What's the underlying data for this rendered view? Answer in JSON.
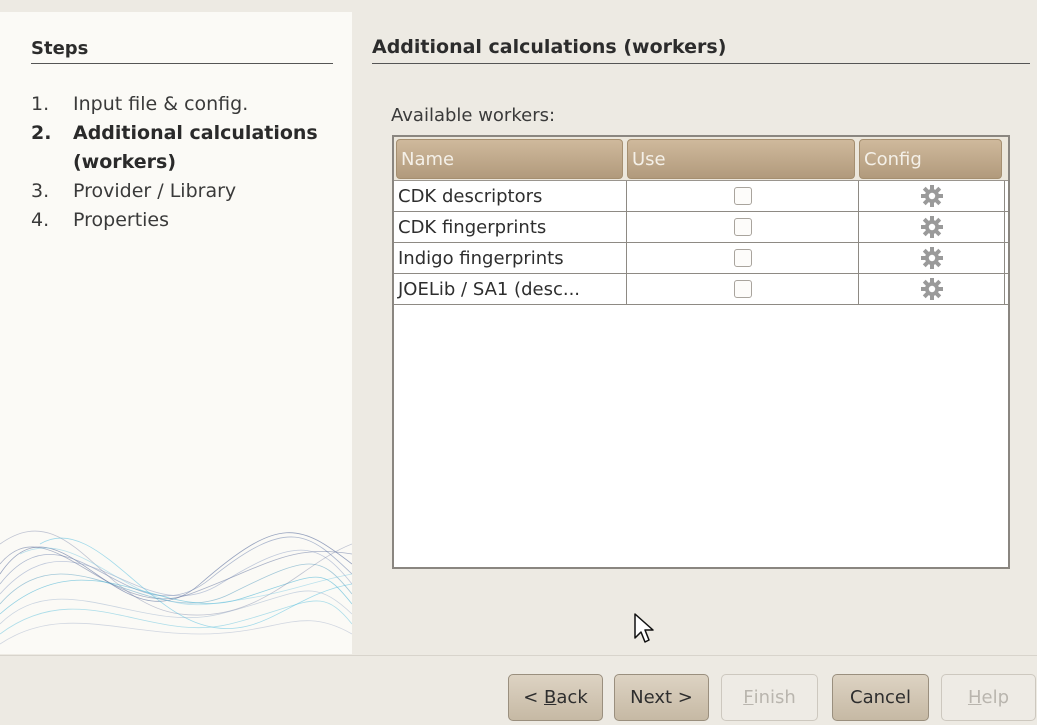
{
  "steps": {
    "title": "Steps",
    "items": [
      {
        "num": "1.",
        "label": "Input file & config.",
        "active": false
      },
      {
        "num": "2.",
        "label": "Additional calculations (workers)",
        "active": true
      },
      {
        "num": "3.",
        "label": "Provider / Library",
        "active": false
      },
      {
        "num": "4.",
        "label": "Properties",
        "active": false
      }
    ]
  },
  "content": {
    "title": "Additional calculations (workers)",
    "available_label": "Available workers:"
  },
  "table": {
    "columns": [
      "Name",
      "Use",
      "Config"
    ],
    "rows": [
      {
        "name": "CDK descriptors",
        "use": false,
        "config_icon": "gear-icon"
      },
      {
        "name": "CDK fingerprints",
        "use": false,
        "config_icon": "gear-icon"
      },
      {
        "name": "Indigo fingerprints",
        "use": false,
        "config_icon": "gear-icon"
      },
      {
        "name": "JOELib / SA1 (desc...",
        "use": false,
        "config_icon": "gear-icon"
      }
    ]
  },
  "buttons": {
    "back": {
      "prefix": "< ",
      "mnemonic": "B",
      "rest": "ack",
      "enabled": true
    },
    "next": {
      "label": "Next >",
      "enabled": true
    },
    "finish": {
      "mnemonic": "F",
      "rest": "inish",
      "enabled": false
    },
    "cancel": {
      "label": "Cancel",
      "enabled": true
    },
    "help": {
      "mnemonic": "H",
      "rest": "elp",
      "enabled": false
    }
  },
  "colors": {
    "header_cell": "#bca588",
    "background": "#edeae3",
    "panel": "#fbfaf6"
  }
}
